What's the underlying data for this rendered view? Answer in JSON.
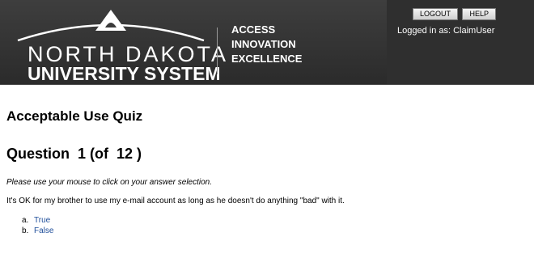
{
  "header": {
    "logo": {
      "line1": "NORTH DAKOTA",
      "line2": "UNIVERSITY SYSTEM"
    },
    "tagline": [
      "ACCESS",
      "INNOVATION",
      "EXCELLENCE"
    ],
    "buttons": {
      "logout": "LOGOUT",
      "help": "HELP"
    },
    "login_status": "Logged in as: ClaimUser"
  },
  "quiz": {
    "title": "Acceptable Use Quiz",
    "question_heading": "Question  1 (of  12 )",
    "instructions": "Please use your mouse to click on your answer selection.",
    "question_text": "It's OK for my brother to use my e-mail account as long as he doesn't do anything \"bad\" with it.",
    "answers": [
      {
        "letter": "a.",
        "label": "True"
      },
      {
        "letter": "b.",
        "label": "False"
      }
    ]
  },
  "colors": {
    "header_bg": "#2f2f2f",
    "link": "#1f4e9a",
    "text": "#000000"
  }
}
